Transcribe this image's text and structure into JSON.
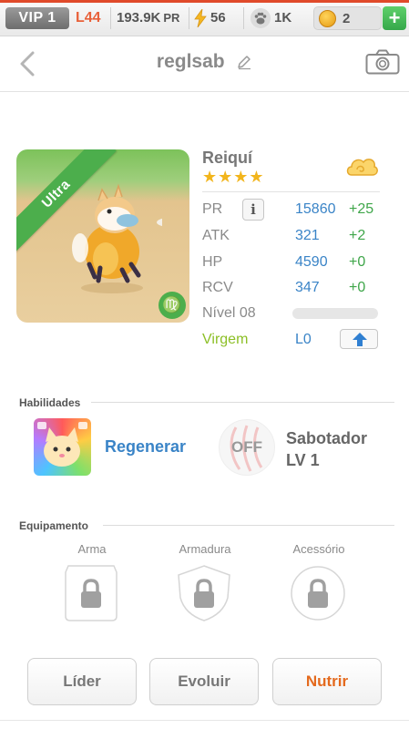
{
  "status_bar": {
    "vip": "VIP 1",
    "level": "L44",
    "power": "193.9K",
    "power_unit": "PR",
    "energy": "56",
    "paws": "1K",
    "coins": "2",
    "add": "+"
  },
  "header": {
    "title": "reglsab"
  },
  "pet": {
    "rarity": "Ultra",
    "name": "Reiquí",
    "stars": "★★★★",
    "zodiac_glyph": "♍",
    "stats": [
      {
        "label": "PR",
        "value": "15860",
        "bonus": "+25"
      },
      {
        "label": "ATK",
        "value": "321",
        "bonus": "+2"
      },
      {
        "label": "HP",
        "value": "4590",
        "bonus": "+0"
      },
      {
        "label": "RCV",
        "value": "347",
        "bonus": "+0"
      }
    ],
    "info_button": "i",
    "level_label": "Nível 08",
    "level_progress": 0.0,
    "sign_label": "Virgem",
    "sign_level": "L0"
  },
  "abilities": {
    "title": "Habilidades",
    "skill1_name": "Regenerar",
    "skill2_state": "OFF",
    "skill2_name": "Sabotador",
    "skill2_level": "LV 1"
  },
  "equipment": {
    "title": "Equipamento",
    "slots": [
      "Arma",
      "Armadura",
      "Acessório"
    ]
  },
  "actions": {
    "leader": "Líder",
    "evolve": "Evoluir",
    "feed": "Nutrir"
  },
  "colors": {
    "accent_blue": "#3a84c7",
    "bonus_green": "#3fa64a",
    "sign_green": "#8cbf26",
    "feed_orange": "#e46a1e",
    "rarity_green": "#4cae4c"
  }
}
